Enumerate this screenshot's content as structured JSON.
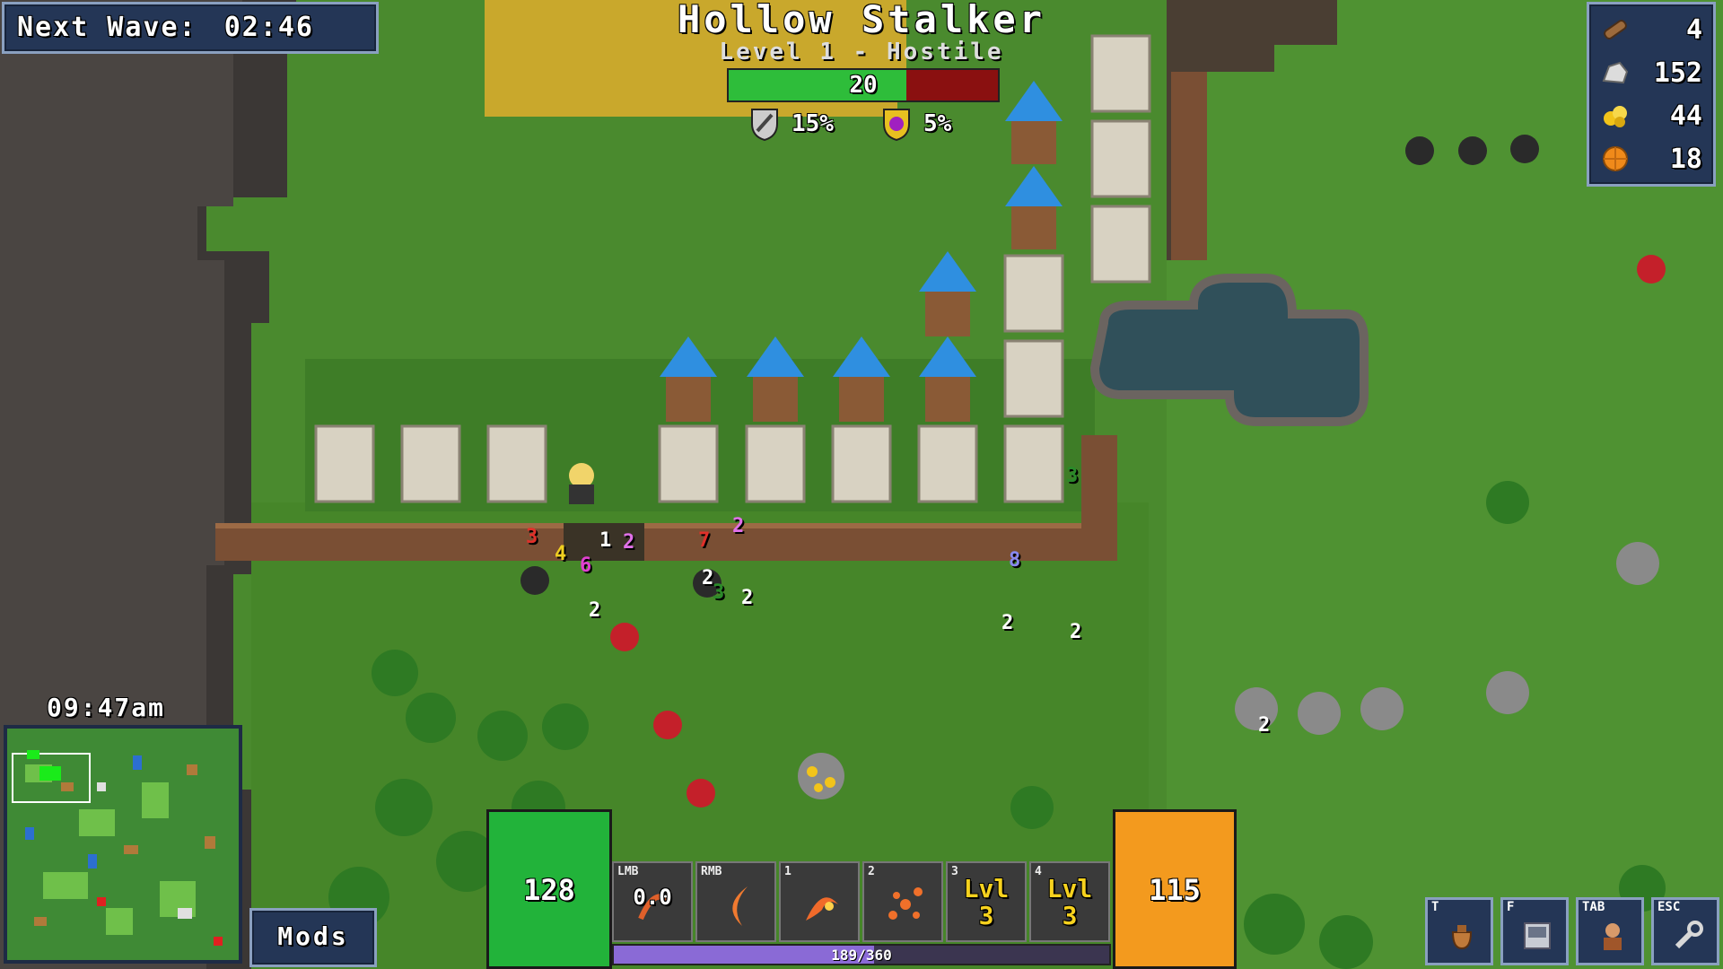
{
  "hud": {
    "next_wave_label": "Next Wave:",
    "next_wave_time": "02:46",
    "clock": "09:47am",
    "mods_label": "Mods"
  },
  "target": {
    "name": "Hollow Stalker",
    "subtitle": "Level 1 - Hostile",
    "hp_value": "20",
    "hp_fraction": 0.66,
    "armor_pct": "15%",
    "resist_pct": "5%"
  },
  "resources": [
    {
      "icon": "wood-log-icon",
      "value": "4"
    },
    {
      "icon": "stone-icon",
      "value": "152"
    },
    {
      "icon": "gold-ore-icon",
      "value": "44"
    },
    {
      "icon": "orange-gem-icon",
      "value": "18"
    }
  ],
  "bars": {
    "health_value": "128",
    "energy_value": "115",
    "xp_text": "189/360",
    "xp_fraction": 0.525
  },
  "hotbar": [
    {
      "key": "LMB",
      "label": "0.0",
      "icon": "fire-claw-icon"
    },
    {
      "key": "RMB",
      "label": "",
      "icon": "crescent-slash-icon"
    },
    {
      "key": "1",
      "label": "",
      "icon": "flame-swirl-icon"
    },
    {
      "key": "2",
      "label": "",
      "icon": "spark-burst-icon"
    },
    {
      "key": "3",
      "label": "Lvl 3",
      "icon": "locked-skill-icon"
    },
    {
      "key": "4",
      "label": "Lvl 3",
      "icon": "locked-skill-icon"
    }
  ],
  "menu": [
    {
      "key": "T",
      "icon": "bag-icon"
    },
    {
      "key": "F",
      "icon": "terminal-icon"
    },
    {
      "key": "TAB",
      "icon": "character-icon"
    },
    {
      "key": "ESC",
      "icon": "wrench-icon"
    }
  ],
  "damage_numbers": [
    "3",
    "4",
    "1",
    "2",
    "6",
    "7",
    "2",
    "2",
    "2",
    "3",
    "2",
    "2",
    "2",
    "8",
    "2",
    "2",
    "2",
    "3"
  ],
  "colors": {
    "grass": "#4a8a2e",
    "health_green": "#22b33a",
    "energy_orange": "#f39a1e",
    "panel_blue": "#243656",
    "hp_red": "#8a1010"
  }
}
